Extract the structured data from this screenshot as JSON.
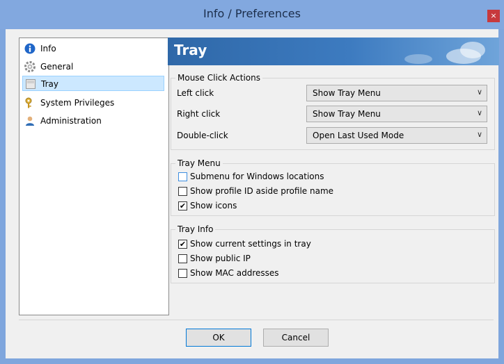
{
  "window": {
    "title": "Info / Preferences",
    "close_glyph": "×"
  },
  "sidebar": {
    "items": [
      {
        "label": "Info",
        "icon": "info-icon"
      },
      {
        "label": "General",
        "icon": "gear-icon"
      },
      {
        "label": "Tray",
        "icon": "tray-icon",
        "selected": true
      },
      {
        "label": "System Privileges",
        "icon": "key-icon"
      },
      {
        "label": "Administration",
        "icon": "user-icon"
      }
    ]
  },
  "page": {
    "title": "Tray"
  },
  "mouse_click": {
    "legend": "Mouse Click Actions",
    "rows": [
      {
        "label": "Left click",
        "value": "Show Tray Menu"
      },
      {
        "label": "Right click",
        "value": "Show Tray Menu"
      },
      {
        "label": "Double-click",
        "value": "Open Last Used Mode"
      }
    ],
    "chevron": "∨"
  },
  "tray_menu": {
    "legend": "Tray Menu",
    "options": [
      {
        "label": "Submenu for Windows locations",
        "checked": false
      },
      {
        "label": "Show profile ID aside profile name",
        "checked": false
      },
      {
        "label": "Show icons",
        "checked": true
      }
    ]
  },
  "tray_info": {
    "legend": "Tray Info",
    "options": [
      {
        "label": "Show current settings in tray",
        "checked": true
      },
      {
        "label": "Show public IP",
        "checked": false
      },
      {
        "label": "Show MAC addresses",
        "checked": false
      }
    ]
  },
  "buttons": {
    "ok": "OK",
    "cancel": "Cancel"
  },
  "check_glyph": "✔"
}
